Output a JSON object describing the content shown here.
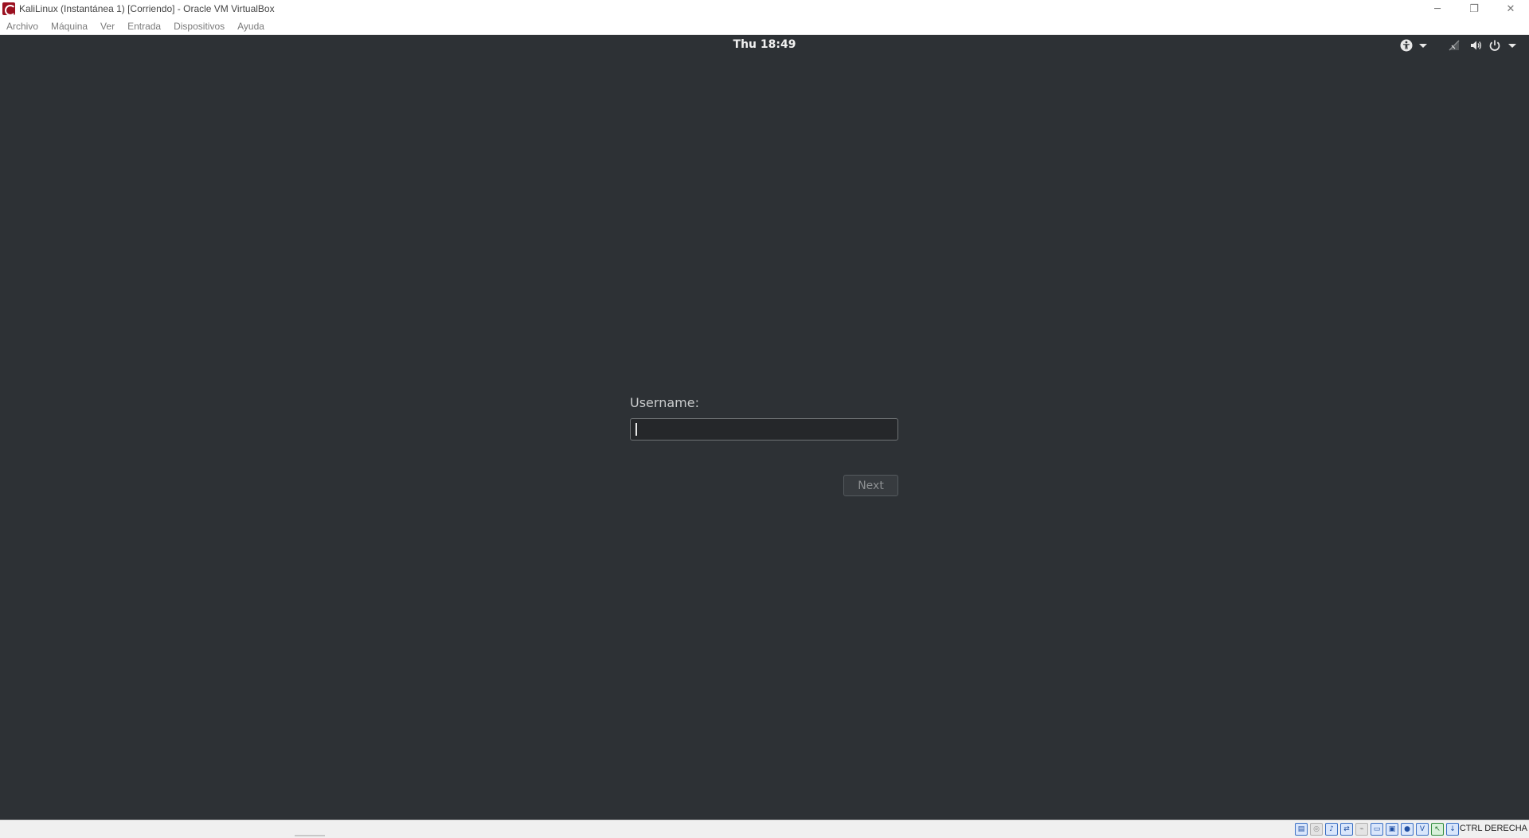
{
  "window": {
    "title": "KaliLinux (Instantánea 1) [Corriendo] - Oracle VM VirtualBox",
    "controls": {
      "minimize": "─",
      "restore": "❐",
      "close": "✕"
    }
  },
  "menubar": {
    "items": [
      "Archivo",
      "Máquina",
      "Ver",
      "Entrada",
      "Dispositivos",
      "Ayuda"
    ]
  },
  "guest": {
    "topbar": {
      "clock": "Thu 18:49",
      "icons": [
        "accessibility-icon",
        "network-icon",
        "volume-icon",
        "power-icon"
      ]
    },
    "login": {
      "label": "Username:",
      "value": "",
      "next_label": "Next"
    }
  },
  "statusbar": {
    "host_key": "CTRL DERECHA",
    "icons": [
      "hard-disk-icon",
      "optical-drive-icon",
      "audio-icon",
      "network-adapter-icon",
      "usb-icon",
      "shared-folders-icon",
      "display-icon",
      "video-capture-icon",
      "virtualization-icon",
      "mouse-integration-icon",
      "keyboard-capture-icon"
    ]
  },
  "colors": {
    "desktop_bg": "#2d3135",
    "input_bg": "#25272a",
    "text_light": "#f0f0f0"
  }
}
